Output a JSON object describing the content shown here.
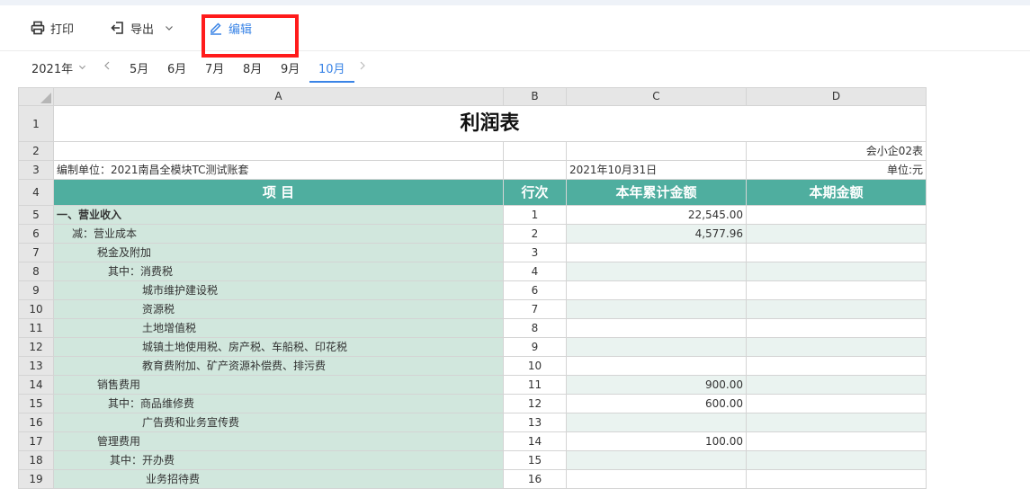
{
  "toolbar": {
    "print_label": "打印",
    "export_label": "导出",
    "edit_label": "编辑"
  },
  "period": {
    "year": "2021年",
    "months": [
      "5月",
      "6月",
      "7月",
      "8月",
      "9月",
      "10月"
    ],
    "active_month": "10月"
  },
  "sheet": {
    "col_headers": [
      "A",
      "B",
      "C",
      "D"
    ],
    "title": "利润表",
    "form_code": "会小企02表",
    "company": "编制单位：2021南昌全模块TC测试账套",
    "date": "2021年10月31日",
    "unit": "单位:元",
    "table_headers": [
      "项  目",
      "行次",
      "本年累计金额",
      "本期金额"
    ],
    "row_numbers": [
      "1",
      "2",
      "3",
      "4",
      "5",
      "6",
      "7",
      "8",
      "9",
      "10",
      "11",
      "12",
      "13",
      "14",
      "15",
      "16",
      "17",
      "18",
      "19"
    ],
    "rows": [
      {
        "item": "一、营业收入",
        "line": "1",
        "ytd": "22,545.00",
        "period": ""
      },
      {
        "item": "减：营业成本",
        "line": "2",
        "ytd": "4,577.96",
        "period": ""
      },
      {
        "item": "税金及附加",
        "line": "3",
        "ytd": "",
        "period": ""
      },
      {
        "item": "其中：消费税",
        "line": "4",
        "ytd": "",
        "period": ""
      },
      {
        "item": "城市维护建设税",
        "line": "6",
        "ytd": "",
        "period": ""
      },
      {
        "item": "资源税",
        "line": "7",
        "ytd": "",
        "period": ""
      },
      {
        "item": "土地增值税",
        "line": "8",
        "ytd": "",
        "period": ""
      },
      {
        "item": "城镇土地使用税、房产税、车船税、印花税",
        "line": "9",
        "ytd": "",
        "period": ""
      },
      {
        "item": "教育费附加、矿产资源补偿费、排污费",
        "line": "10",
        "ytd": "",
        "period": ""
      },
      {
        "item": "销售费用",
        "line": "11",
        "ytd": "900.00",
        "period": ""
      },
      {
        "item": "其中：商品维修费",
        "line": "12",
        "ytd": "600.00",
        "period": ""
      },
      {
        "item": "广告费和业务宣传费",
        "line": "13",
        "ytd": "",
        "period": ""
      },
      {
        "item": "管理费用",
        "line": "14",
        "ytd": "100.00",
        "period": ""
      },
      {
        "item": "其中：开办费",
        "line": "15",
        "ytd": "",
        "period": ""
      },
      {
        "item": "业务招待费",
        "line": "16",
        "ytd": "",
        "period": ""
      }
    ]
  }
}
